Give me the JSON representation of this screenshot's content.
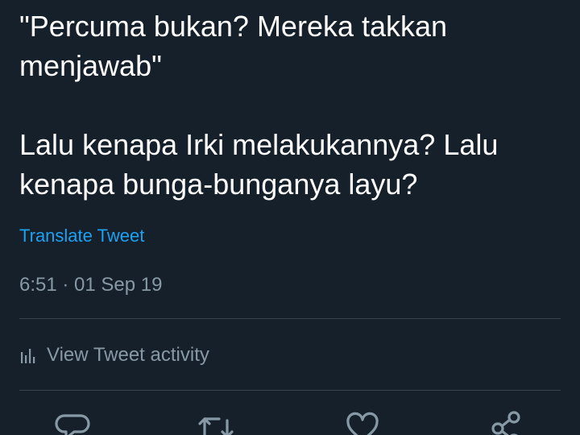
{
  "tweet": {
    "line1": "\"Percuma bukan? Mereka takkan",
    "line2": "menjawab\"",
    "line3": "Lalu kenapa Irki melakukannya? Lalu",
    "line4": "kenapa bunga-bunganya layu?"
  },
  "translate_label": "Translate Tweet",
  "timestamp": "6:51 · 01 Sep 19",
  "activity": {
    "label": "View Tweet activity",
    "icon": "bar-chart-icon"
  },
  "action_bar": {
    "icons": [
      "reply-icon",
      "retweet-icon",
      "like-icon",
      "share-icon"
    ]
  },
  "colors": {
    "background": "#15202b",
    "text": "#ffffff",
    "link": "#1da1f2",
    "secondary": "#8899a6",
    "divider": "#38444d"
  }
}
